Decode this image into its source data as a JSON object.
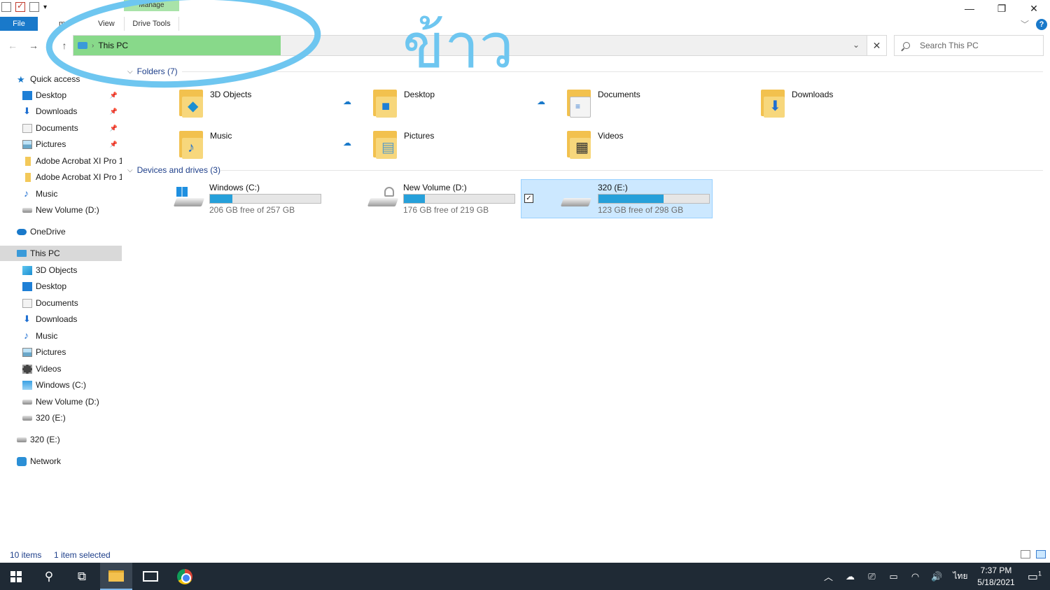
{
  "ribbon": {
    "file_tab": "File",
    "contextual_tab": "Manage",
    "drive_tools_tab": "Drive Tools",
    "partial_tab_1": "mp",
    "partial_tab_2": "View"
  },
  "address": {
    "crumb": "This PC",
    "search_placeholder": "Search This PC"
  },
  "sidebar": {
    "quick_access": "Quick access",
    "quick_items": [
      {
        "label": "Desktop",
        "icon": "desktop-icon",
        "pinned": true
      },
      {
        "label": "Downloads",
        "icon": "downloads-icon",
        "pinned": true
      },
      {
        "label": "Documents",
        "icon": "documents-icon",
        "pinned": true
      },
      {
        "label": "Pictures",
        "icon": "pictures-icon",
        "pinned": true
      },
      {
        "label": "Adobe Acrobat XI Pro 1",
        "icon": "folder-icon",
        "pinned": false
      },
      {
        "label": "Adobe Acrobat XI Pro 1",
        "icon": "folder-icon",
        "pinned": false
      },
      {
        "label": "Music",
        "icon": "music-icon",
        "pinned": false
      },
      {
        "label": "New Volume (D:)",
        "icon": "drive-icon",
        "pinned": false
      }
    ],
    "onedrive": "OneDrive",
    "this_pc": "This PC",
    "pc_items": [
      {
        "label": "3D Objects"
      },
      {
        "label": "Desktop"
      },
      {
        "label": "Documents"
      },
      {
        "label": "Downloads"
      },
      {
        "label": "Music"
      },
      {
        "label": "Pictures"
      },
      {
        "label": "Videos"
      },
      {
        "label": "Windows (C:)"
      },
      {
        "label": "New Volume (D:)"
      },
      {
        "label": "320 (E:)"
      }
    ],
    "drive_e": "320 (E:)",
    "network": "Network"
  },
  "content": {
    "folders_header": "Folders (7)",
    "folders": [
      {
        "name": "3D Objects",
        "glyph": "3d-cube-icon",
        "synced": true
      },
      {
        "name": "Desktop",
        "glyph": "desktop-icon",
        "synced": true
      },
      {
        "name": "Documents",
        "glyph": "documents-icon",
        "synced": false
      },
      {
        "name": "Downloads",
        "glyph": "downloads-icon",
        "synced": false
      },
      {
        "name": "Music",
        "glyph": "music-icon",
        "synced": true
      },
      {
        "name": "Pictures",
        "glyph": "pictures-icon",
        "synced": false
      },
      {
        "name": "Videos",
        "glyph": "videos-icon",
        "synced": false
      }
    ],
    "devices_header": "Devices and drives (3)",
    "drives": [
      {
        "name": "Windows (C:)",
        "free": "206 GB free of 257 GB",
        "used_fraction": 0.2,
        "selected": false
      },
      {
        "name": "New Volume (D:)",
        "free": "176 GB free of 219 GB",
        "used_fraction": 0.19,
        "selected": false
      },
      {
        "name": "320 (E:)",
        "free": "123 GB free of 298 GB",
        "used_fraction": 0.59,
        "selected": true
      }
    ]
  },
  "status": {
    "items": "10 items",
    "selected": "1 item selected"
  },
  "taskbar": {
    "time": "7:37 PM",
    "date": "5/18/2021",
    "lang": "ไทย",
    "notif_count": "1"
  },
  "overlay": {
    "handwriting": "ข้าว"
  },
  "colors": {
    "accent": "#1979ca",
    "scribble": "#6ec6f0",
    "crumb_highlight": "#88d98a",
    "selection": "#cce8ff",
    "drive_bar": "#26a0da"
  }
}
